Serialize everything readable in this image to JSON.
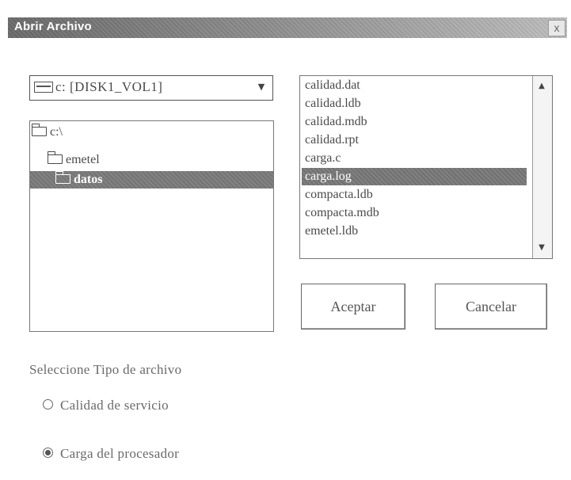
{
  "dialog": {
    "title": "Abrir Archivo",
    "close_label": "x"
  },
  "drive": {
    "selected": "c: [DISK1_VOL1]",
    "dropdown_arrow": "▼"
  },
  "directories": [
    {
      "label": "c:\\",
      "selected": false
    },
    {
      "label": "emetel",
      "selected": false
    },
    {
      "label": "datos",
      "selected": true
    }
  ],
  "files": [
    {
      "name": "calidad.dat",
      "selected": false
    },
    {
      "name": "calidad.ldb",
      "selected": false
    },
    {
      "name": "calidad.mdb",
      "selected": false
    },
    {
      "name": "calidad.rpt",
      "selected": false
    },
    {
      "name": "carga.c",
      "selected": false
    },
    {
      "name": "carga.log",
      "selected": true
    },
    {
      "name": "compacta.ldb",
      "selected": false
    },
    {
      "name": "compacta.mdb",
      "selected": false
    },
    {
      "name": "emetel.ldb",
      "selected": false
    }
  ],
  "buttons": {
    "ok": "Aceptar",
    "cancel": "Cancelar"
  },
  "file_type": {
    "label": "Seleccione Tipo de archivo",
    "options": [
      {
        "label": "Calidad de servicio",
        "checked": false
      },
      {
        "label": "Carga del procesador",
        "checked": true
      }
    ]
  }
}
